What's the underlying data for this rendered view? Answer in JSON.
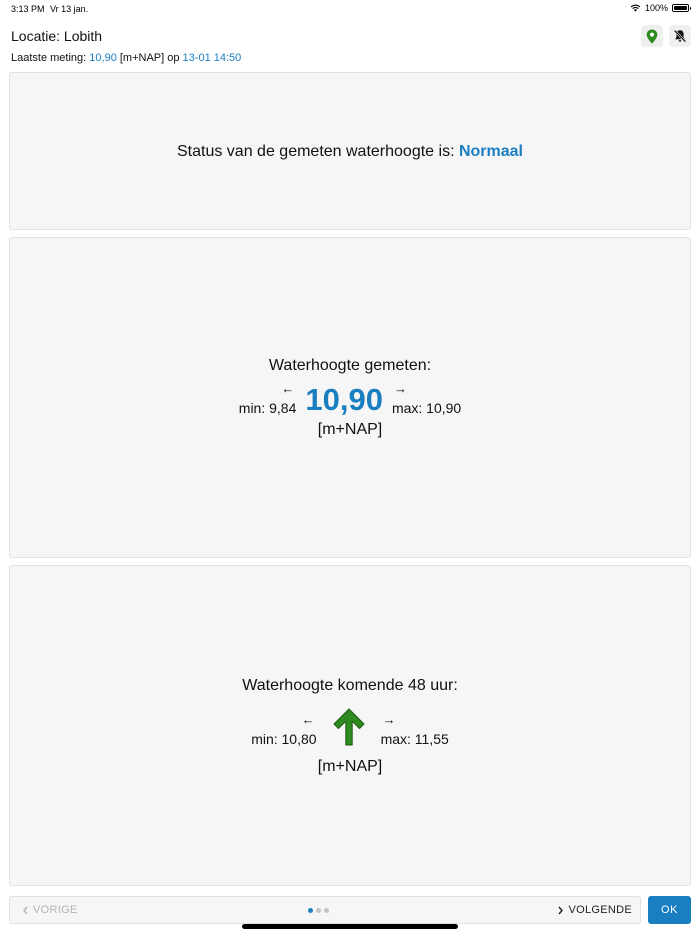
{
  "status_bar": {
    "time": "3:13 PM",
    "date": "Vr 13 jan.",
    "battery": "100%",
    "icons": [
      "wifi-icon",
      "battery-icon"
    ]
  },
  "header": {
    "title": "Locatie: Lobith",
    "actions": [
      "location-pin-icon",
      "notification-off-icon"
    ],
    "last_measure": {
      "prefix": "Laatste meting:",
      "value": "10,90",
      "unit": "[m+NAP] op",
      "datetime": "13-01 14:50"
    }
  },
  "status_card": {
    "text": "Status van de gemeten waterhoogte is:",
    "status": "Normaal"
  },
  "measured_card": {
    "title": "Waterhoogte gemeten:",
    "min_arrow": "←",
    "min": "min: 9,84",
    "value": "10,90",
    "max_arrow": "→",
    "max": "max: 10,90",
    "unit": "[m+NAP]"
  },
  "forecast_card": {
    "title": "Waterhoogte komende 48 uur:",
    "min_arrow": "←",
    "min": "min: 10,80",
    "trend_icon": "arrow-up-icon",
    "max_arrow": "→",
    "max": "max: 11,55",
    "unit": "[m+NAP]"
  },
  "navigation": {
    "prev_label": "VORIGE",
    "next_label": "VOLGENDE",
    "ok_label": "OK",
    "page_count": 3,
    "active_page": 1
  },
  "colors": {
    "accent": "#1a7fc1",
    "trend_arrow": "#2e8b1f",
    "location_pin": "#2e8b1f"
  }
}
